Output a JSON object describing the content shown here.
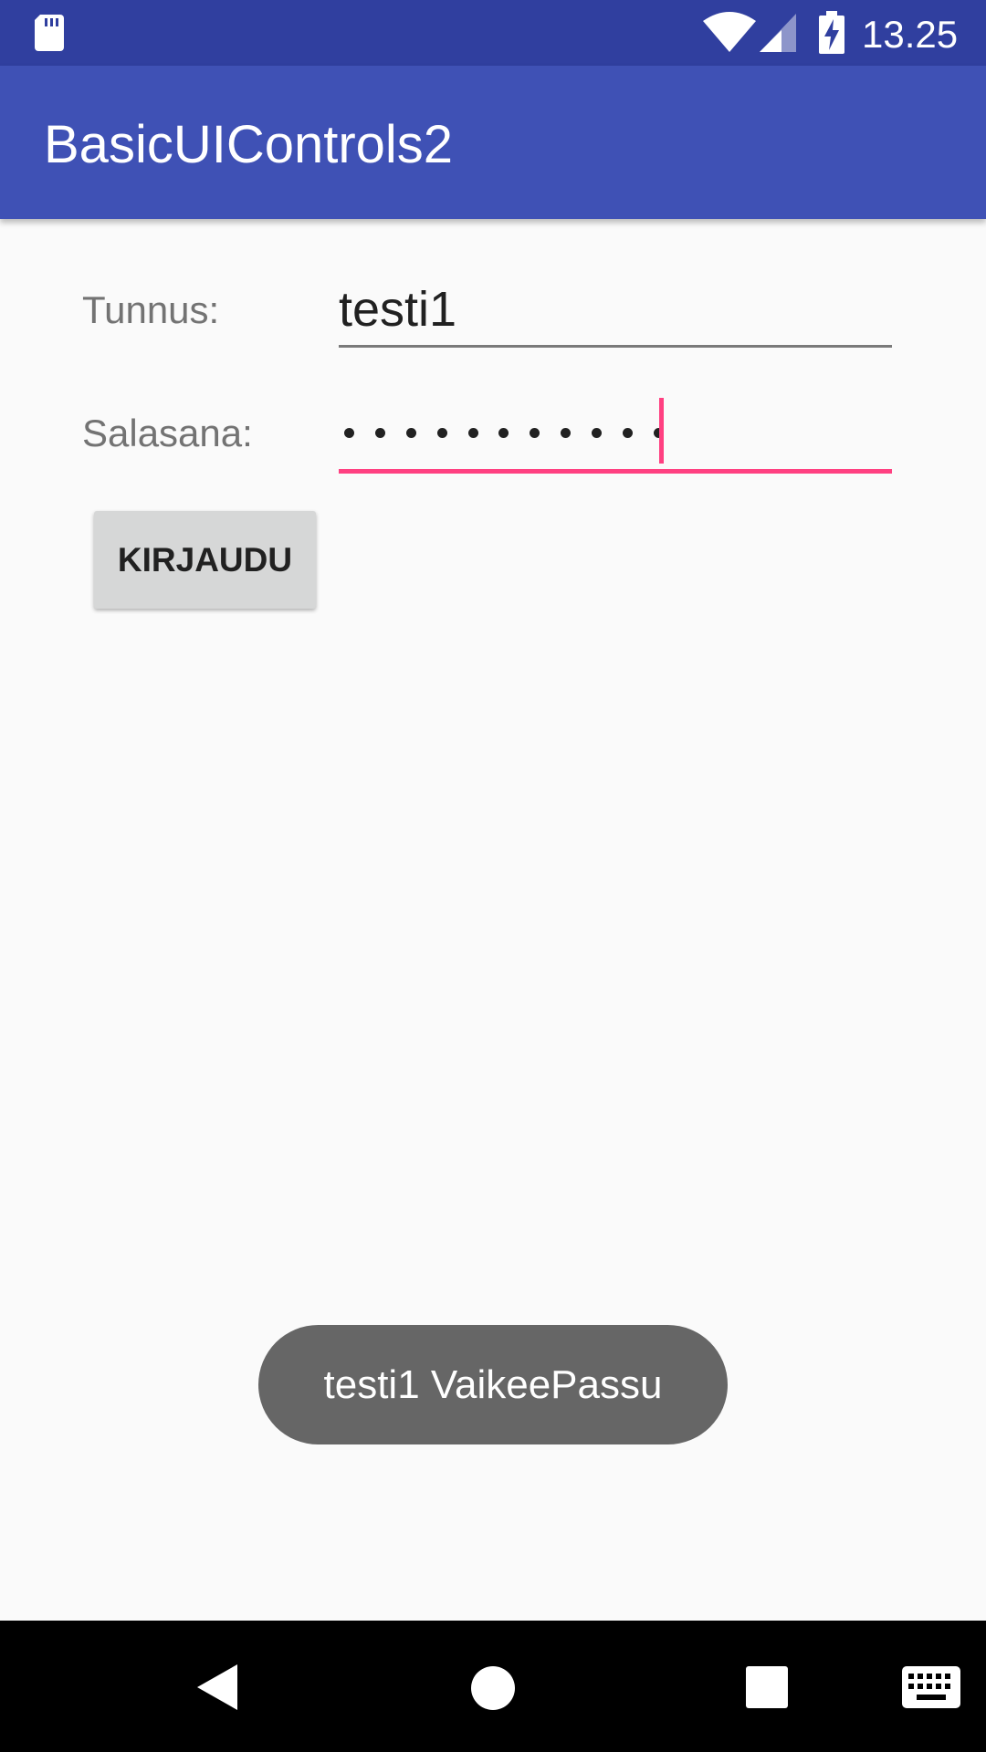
{
  "status_bar": {
    "time": "13.25",
    "background": "#303f9f",
    "icons": [
      "sd-card-icon",
      "wifi-icon",
      "signal-icon",
      "battery-charging-icon"
    ]
  },
  "app_bar": {
    "title": "BasicUIControls2",
    "background": "#3f51b5"
  },
  "form": {
    "username_label": "Tunnus:",
    "username_value": "testi1",
    "password_label": "Salasana:",
    "password_masked": "•••••••••••",
    "password_length": 11,
    "accent": "#ff4081"
  },
  "login_button": {
    "label": "KIRJAUDU"
  },
  "toast": {
    "message": "testi1 VaikeePassu"
  },
  "nav_bar": {
    "icons": [
      "back-icon",
      "home-icon",
      "recents-icon",
      "keyboard-icon"
    ]
  }
}
